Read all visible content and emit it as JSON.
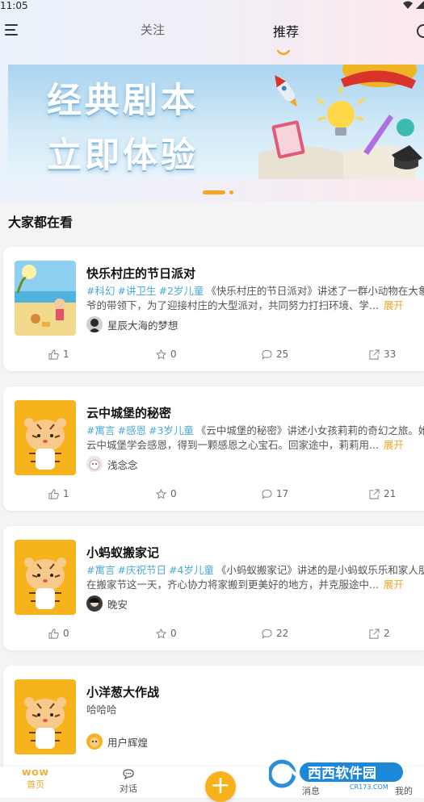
{
  "status": {
    "time": "11:05"
  },
  "nav": {
    "tabs": [
      {
        "label": "关注"
      },
      {
        "label": "推荐"
      }
    ]
  },
  "banner": {
    "line1": "经典剧本",
    "line2": "立即体验",
    "slides_count": 2,
    "active_slide": 1
  },
  "section": {
    "title": "大家都在看"
  },
  "cards": [
    {
      "title": "快乐村庄的节日派对",
      "tags": [
        "#科幻",
        "#讲卫生",
        "#2岁儿童"
      ],
      "line1_text": "《快乐村庄的节日派对》讲述了一群小动物在大象爷",
      "line2_text": "爷的带领下，为了迎接村庄的大型派对，共同努力打扫环境、学...",
      "expand": "展开",
      "author": "星辰大海的梦想",
      "likes": "1",
      "favorites": "0",
      "comments": "25",
      "shares": "33"
    },
    {
      "title": "云中城堡的秘密",
      "tags": [
        "#寓言",
        "#感恩",
        "#3岁儿童"
      ],
      "line1_text": "《云中城堡的秘密》讲述小女孩莉莉的奇幻之旅。她在",
      "line2_text": "云中城堡学会感恩，得到一颗感恩之心宝石。回家途中，莉莉用...",
      "expand": "展开",
      "author": "浅念念",
      "likes": "1",
      "favorites": "0",
      "comments": "17",
      "shares": "21"
    },
    {
      "title": "小蚂蚁搬家记",
      "tags": [
        "#寓言",
        "#庆祝节日",
        "#4岁儿童"
      ],
      "line1_text": "《小蚂蚁搬家记》讲述的是小蚂蚁乐乐和家人朋友",
      "line2_text": "在搬家节这一天，齐心协力将家搬到更美好的地方，并克服途中...",
      "expand": "展开",
      "author": "晚安",
      "likes": "0",
      "favorites": "0",
      "comments": "22",
      "shares": "2"
    },
    {
      "title": "小洋葱大作战",
      "body": "哈哈哈",
      "author": "用户辉煌"
    }
  ],
  "bottom_nav": {
    "home": "首页",
    "home_logo": "WOW",
    "chat": "对话",
    "plus": "+",
    "news": "消息",
    "mine": "我的"
  },
  "watermark": {
    "text": "西西软件园",
    "sub": "CR173.COM"
  },
  "colors": {
    "accent": "#f5a623",
    "tag": "#4aa8d8"
  }
}
